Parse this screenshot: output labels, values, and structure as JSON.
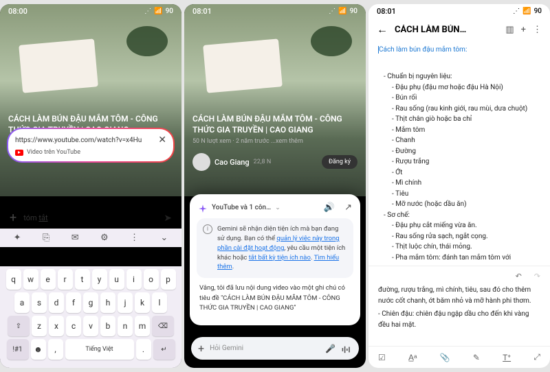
{
  "s1": {
    "time": "08:00",
    "batt": "90",
    "url": "https://www.youtube.com/watch?v=x4Hu",
    "chip_label": "Video trên YouTube",
    "input": "tóm ",
    "input_u": "tắt",
    "title": "CÁCH LÀM BÚN ĐẬU MẮM TÔM - CÔNG THỨC GIA TRUYỀN | CAO GIANG",
    "tb": [
      "✦",
      "⎘",
      "✉",
      "⚙",
      "⋮",
      "⌄"
    ],
    "r1": [
      "q",
      "w",
      "e",
      "r",
      "t",
      "y",
      "u",
      "i",
      "o",
      "p"
    ],
    "r2": [
      "a",
      "s",
      "d",
      "f",
      "g",
      "h",
      "j",
      "k",
      "l"
    ],
    "r3s": "⇧",
    "r3": [
      "z",
      "x",
      "c",
      "v",
      "b",
      "n",
      "m"
    ],
    "r3b": "⌫",
    "r4": [
      "!#1",
      "☻",
      ",",
      "Tiếng Việt",
      ".",
      "↵"
    ]
  },
  "s2": {
    "time": "08:01",
    "batt": "90",
    "title": "CÁCH LÀM BÚN ĐẬU MẮM TÔM - CÔNG THỨC GIA TRUYỀN | CAO GIANG",
    "views": "50 N lượt xem",
    "age": "2 năm trước",
    "more": "...xem thêm",
    "channel": "Cao Giang",
    "subs": "22,8 N",
    "sub_btn": "Đăng ký",
    "g_src": "YouTube và 1 côn…",
    "g_info_1": "Gemini sẽ nhận diện tiện ích mà bạn đang sử dụng. Bạn có thể ",
    "g_link1": "quản lý việc này trong phần cài đặt hoạt động",
    "g_info_2": ", yêu cầu một tiện ích khác hoặc ",
    "g_link2": "tắt bất kỳ tiện ích nào",
    "g_info_3": ". ",
    "g_link3": "Tìm hiểu thêm",
    "g_info_4": ".",
    "g_resp": "Vâng, tôi đã lưu nội dung video vào một ghi chú có tiêu đề \"CÁCH LÀM BÚN ĐẬU MẮM TÔM - CÔNG THỨC GIA TRUYỀN | CAO GIANG\"",
    "g_ph": "Hỏi Gemini"
  },
  "s3": {
    "time": "08:01",
    "batt": "90",
    "title": "CÁCH LÀM BÚN…",
    "line1": "Cách làm bún đậu mắm tôm:",
    "h1": "Chuẩn bị nguyên liệu:",
    "ing": [
      "Đậu phụ (đậu mơ hoặc đậu Hà Nội)",
      "Bún rối",
      "Rau sống (rau kinh giới, rau mùi, dưa chuột)",
      "Thịt chân giò hoặc ba chỉ",
      "Mắm tôm",
      "Chanh",
      "Đường",
      "Rượu trắng",
      "Ớt",
      "Mì chính",
      "Tiêu",
      "Mỡ nước (hoặc dầu ăn)"
    ],
    "h2": "Sơ chế:",
    "prep": [
      "Đậu phụ cắt miếng vừa ăn.",
      "Rau sống rửa sạch, ngắt cọng.",
      "Thịt luộc chín, thái mỏng.",
      "Pha mắm tôm: đánh tan mắm tôm với"
    ],
    "p2": "đường, rượu trắng, mì chính, tiêu, sau đó cho thêm nước cốt chanh, ớt băm nhỏ và mỡ hành phi thơm.",
    "p3": "- Chiên đậu: chiên đậu ngập dầu cho đến khi vàng đều hai mặt."
  }
}
